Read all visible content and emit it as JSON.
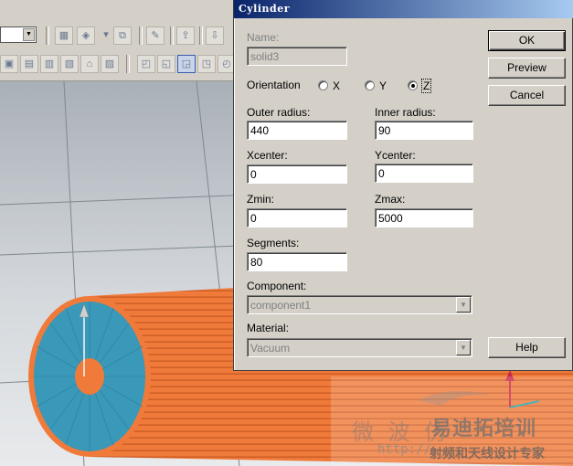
{
  "dialog": {
    "title": "Cylinder",
    "name": {
      "label": "Name:",
      "value": "solid3"
    },
    "orientation": {
      "label": "Orientation",
      "options": [
        "X",
        "Y",
        "Z"
      ],
      "selected": "Z"
    },
    "outer_radius": {
      "label": "Outer radius:",
      "value": "440"
    },
    "inner_radius": {
      "label": "Inner radius:",
      "value": "90"
    },
    "xcenter": {
      "label": "Xcenter:",
      "value": "0"
    },
    "ycenter": {
      "label": "Ycenter:",
      "value": "0"
    },
    "zmin": {
      "label": "Zmin:",
      "value": "0"
    },
    "zmax": {
      "label": "Zmax:",
      "value": "5000"
    },
    "segments": {
      "label": "Segments:",
      "value": "80"
    },
    "component": {
      "label": "Component:",
      "value": "component1"
    },
    "material": {
      "label": "Material:",
      "value": "Vacuum"
    },
    "buttons": {
      "ok": "OK",
      "preview": "Preview",
      "cancel": "Cancel",
      "help": "Help"
    }
  },
  "watermark": {
    "line1": "微 波 仿",
    "brand": "易迪拓培训",
    "url": "http://",
    "subtitle": "射频和天线设计专家"
  },
  "colors": {
    "cylinder_body": "#f07a3a",
    "cylinder_cap": "#3a98b8",
    "viewport_bg": "#c4c8cc",
    "title_bar": "#0a246a"
  }
}
